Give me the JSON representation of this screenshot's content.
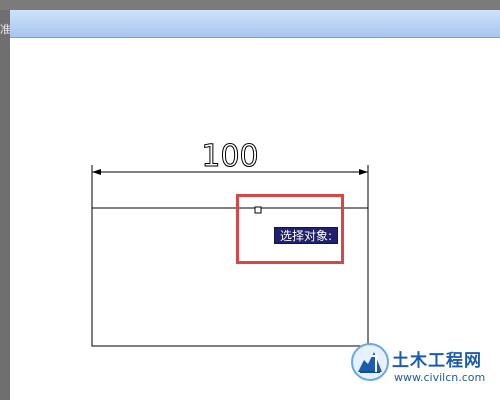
{
  "app": {
    "left_hint": "准"
  },
  "drawing": {
    "dimension_value": "100",
    "prompt": "选择对象:"
  },
  "watermark": {
    "brand": "土木工程网",
    "url": "www.civilcn.com"
  },
  "colors": {
    "selection_box": "#d94646",
    "tooltip_bg": "#20206c",
    "tooltip_text": "#ffffff",
    "line": "#000000",
    "brand_blue": "#1d5ca8"
  },
  "icons": {
    "watermark": "civil-engineering-logo-icon",
    "cursor": "pickbox-cursor-icon"
  }
}
